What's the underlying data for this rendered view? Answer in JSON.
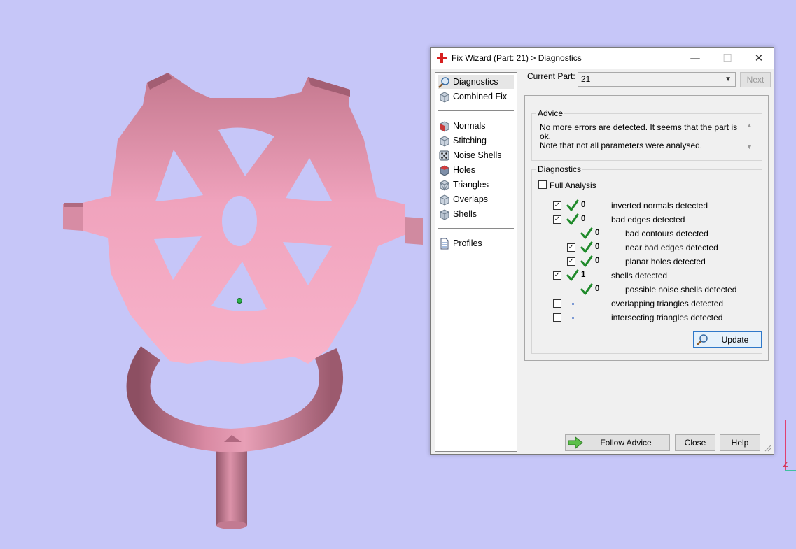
{
  "window": {
    "title": "Fix Wizard (Part: 21) > Diagnostics",
    "minimize_glyph": "—",
    "maximize_glyph": "☐",
    "close_glyph": "✕"
  },
  "sidebar": {
    "items": [
      {
        "label": "Diagnostics",
        "icon": "magnifier-icon",
        "active": true
      },
      {
        "label": "Combined Fix",
        "icon": "cube-icon"
      },
      {
        "label": "Normals",
        "icon": "cube-red-icon"
      },
      {
        "label": "Stitching",
        "icon": "cube-stitch-icon"
      },
      {
        "label": "Noise Shells",
        "icon": "dice-icon"
      },
      {
        "label": "Holes",
        "icon": "cube-hole-icon"
      },
      {
        "label": "Triangles",
        "icon": "cube-triangles-icon"
      },
      {
        "label": "Overlaps",
        "icon": "cube-overlap-icon"
      },
      {
        "label": "Shells",
        "icon": "cube-shells-icon"
      },
      {
        "label": "Profiles",
        "icon": "document-icon"
      }
    ]
  },
  "current_part": {
    "label": "Current Part:",
    "value": "21"
  },
  "next_label": "Next",
  "advice": {
    "title": "Advice",
    "line1": "No more errors are detected. It seems that the part is ok.",
    "line2": "Note that not all parameters were analysed."
  },
  "diagnostics": {
    "title": "Diagnostics",
    "full_analysis_label": "Full Analysis",
    "full_analysis_checked": false,
    "rows": [
      {
        "checkbox": true,
        "checked": true,
        "status": "ok",
        "count": "0",
        "text": "inverted normals detected",
        "indent": 0
      },
      {
        "checkbox": true,
        "checked": true,
        "status": "ok",
        "count": "0",
        "text": "bad edges detected",
        "indent": 0
      },
      {
        "checkbox": false,
        "status": "ok",
        "count": "0",
        "text": "bad contours detected",
        "indent": 1
      },
      {
        "checkbox": true,
        "checked": true,
        "status": "ok",
        "count": "0",
        "text": "near bad edges detected",
        "indent": 1
      },
      {
        "checkbox": true,
        "checked": true,
        "status": "ok",
        "count": "0",
        "text": "planar holes detected",
        "indent": 1
      },
      {
        "checkbox": true,
        "checked": true,
        "status": "ok",
        "count": "1",
        "text": "shells detected",
        "indent": 0
      },
      {
        "checkbox": false,
        "status": "ok",
        "count": "0",
        "text": "possible noise shells detected",
        "indent": 1
      },
      {
        "checkbox": true,
        "checked": false,
        "status": "none",
        "count": "",
        "text": "overlapping triangles detected",
        "indent": 0
      },
      {
        "checkbox": true,
        "checked": false,
        "status": "none",
        "count": "",
        "text": "intersecting triangles detected",
        "indent": 0
      }
    ],
    "update_label": "Update"
  },
  "footer": {
    "follow_advice": "Follow Advice",
    "close": "Close",
    "help": "Help"
  },
  "viewport": {
    "background": "#c6c6f8",
    "part_color": "#f2a6c0",
    "axis_label": "Z"
  }
}
